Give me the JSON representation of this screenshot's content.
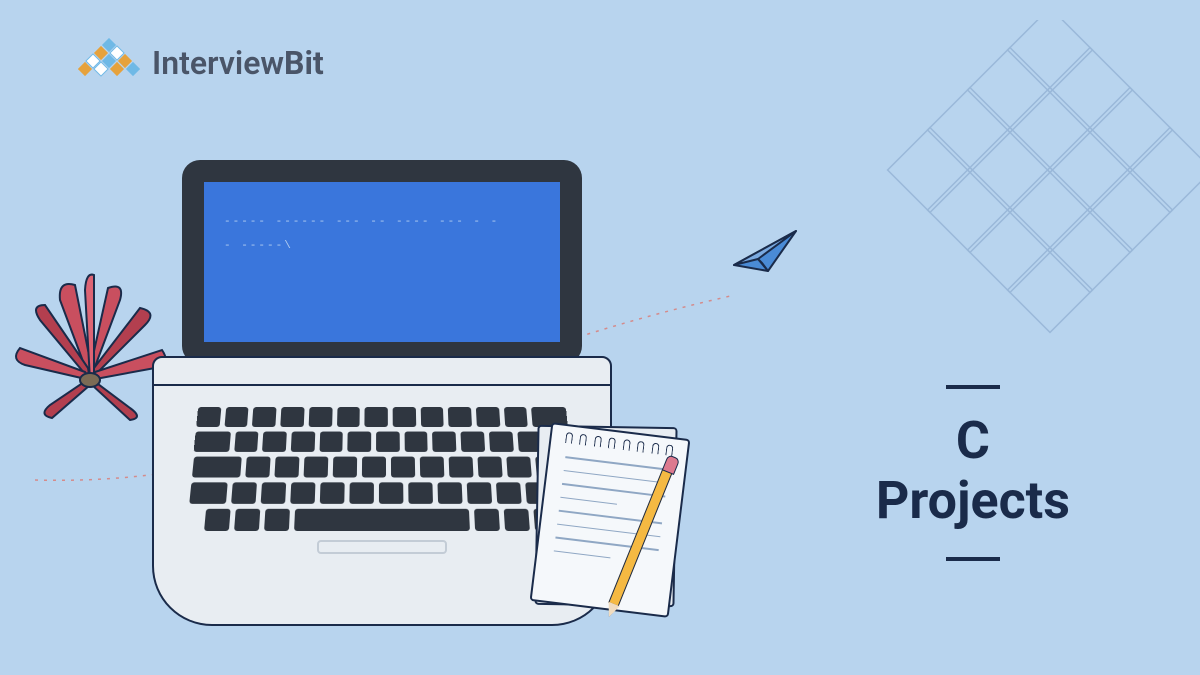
{
  "brand": {
    "name_part1": "Interview",
    "name_part2": "Bit"
  },
  "title": {
    "line1": "C",
    "line2": "Projects"
  },
  "code": {
    "line1": "----- ------ --- --   ---- --- - -",
    "line2": "- -----\\"
  },
  "colors": {
    "background": "#b8d4ee",
    "dark": "#1a2b4a",
    "screen": "#3a76dc",
    "plant": "#c94f5f",
    "pencil": "#f5b942"
  },
  "icons": {
    "logo": "diamond-grid-logo",
    "plane": "paper-plane-icon",
    "plant": "plant-icon",
    "laptop": "laptop-icon",
    "notepad": "notepad-icon",
    "pencil": "pencil-icon"
  }
}
